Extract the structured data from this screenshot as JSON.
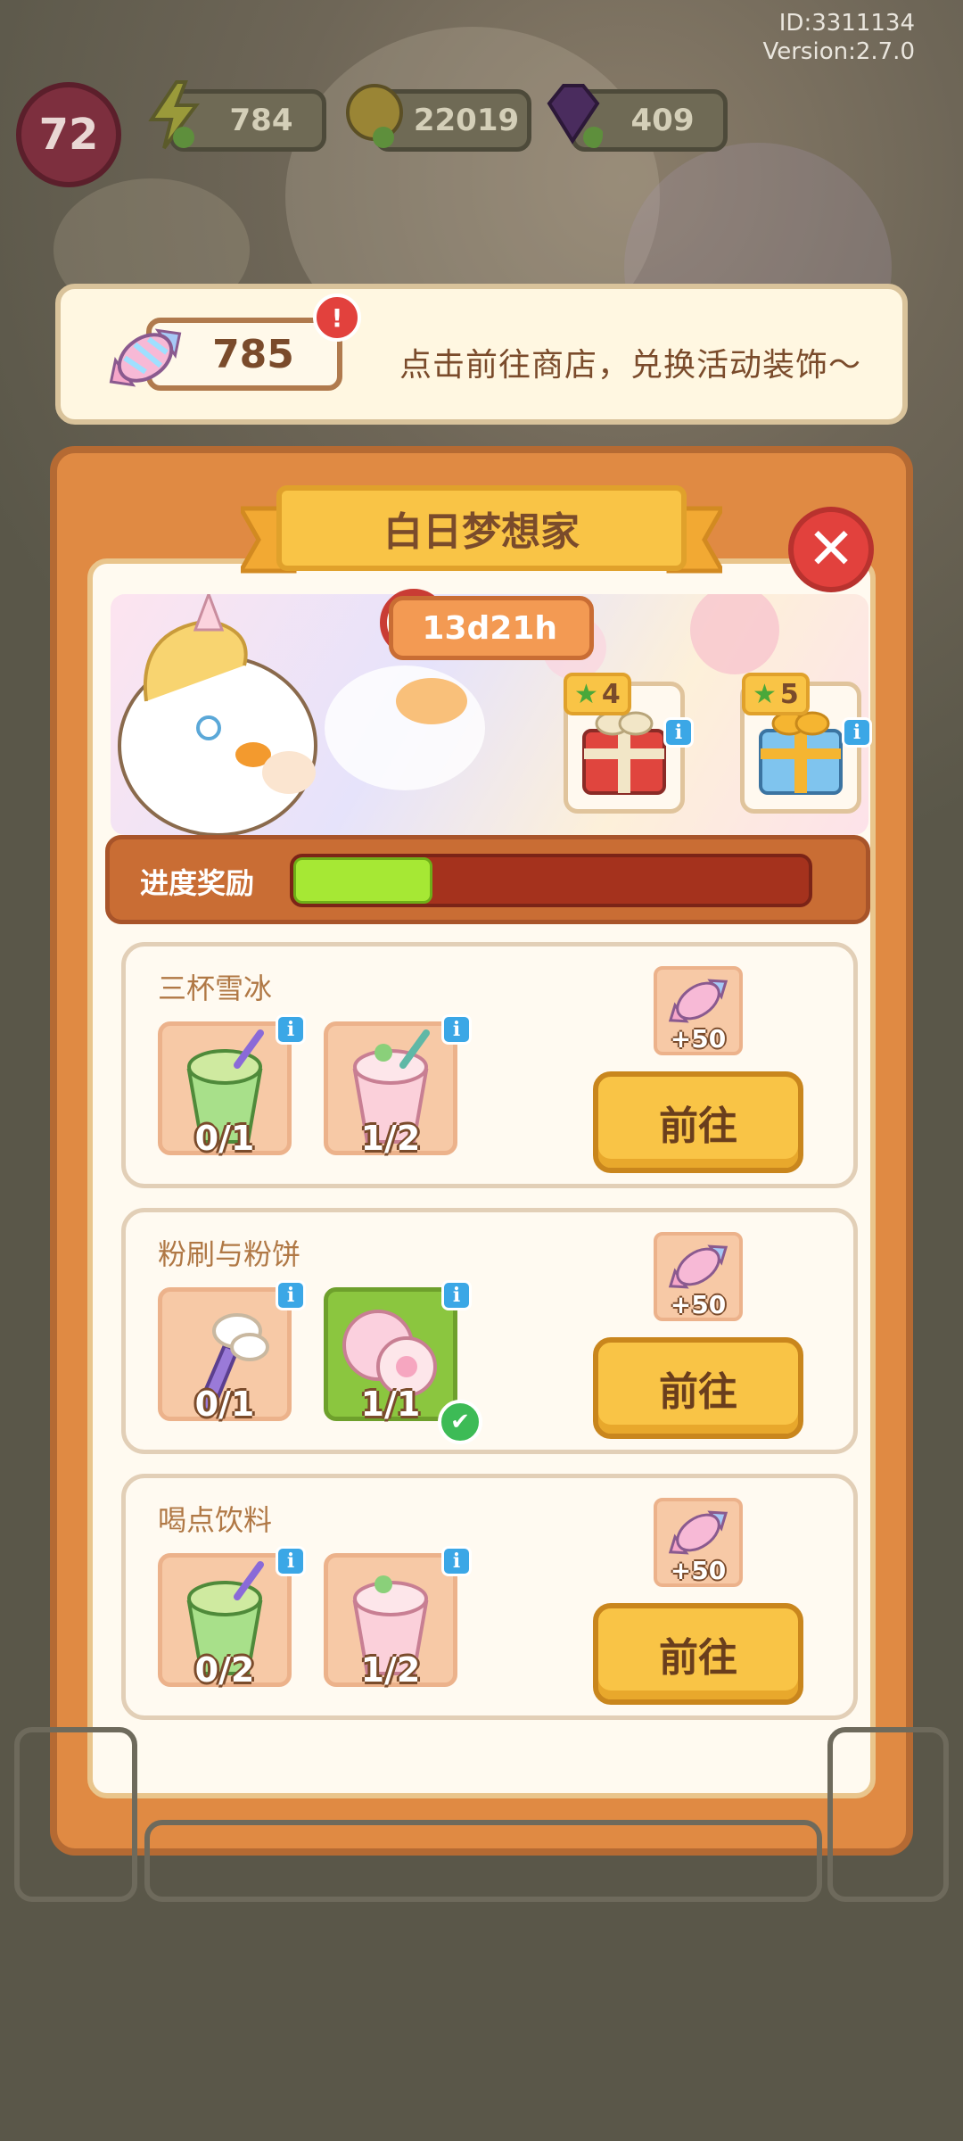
{
  "meta": {
    "id": "ID:3311134",
    "version": "Version:2.7.0"
  },
  "hud": {
    "level": "72",
    "energy": "784",
    "coins": "22019",
    "gems": "409"
  },
  "banner": {
    "candy_count": "785",
    "alert": "!",
    "message": "点击前往商店，兑换活动装饰～"
  },
  "event": {
    "title": "白日梦想家",
    "close": "✕",
    "timer": "13d21h",
    "gifts": [
      {
        "stars": "4"
      },
      {
        "stars": "5"
      }
    ],
    "progress_label": "进度奖励",
    "progress_fraction": 0.27
  },
  "tasks": [
    {
      "title": "三杯雪冰",
      "items": [
        {
          "count": "0/1"
        },
        {
          "count": "1/2"
        }
      ],
      "reward": "+50",
      "button": "前往"
    },
    {
      "title": "粉刷与粉饼",
      "items": [
        {
          "count": "0/1"
        },
        {
          "count": "1/1"
        }
      ],
      "reward": "+50",
      "button": "前往"
    },
    {
      "title": "喝点饮料",
      "items": [
        {
          "count": "0/2"
        },
        {
          "count": "1/2"
        }
      ],
      "reward": "+50",
      "button": "前往"
    }
  ],
  "info_glyph": "i",
  "check_glyph": "✔"
}
